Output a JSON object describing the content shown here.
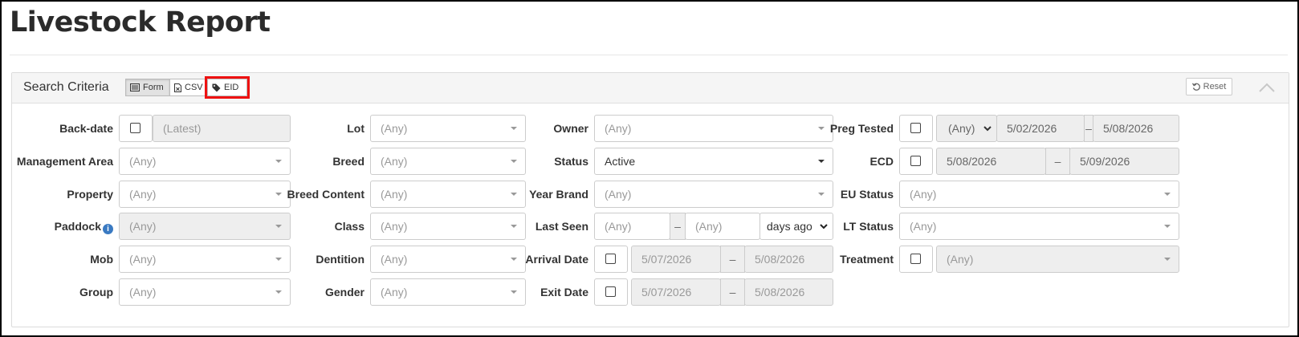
{
  "page": {
    "title": "Livestock Report"
  },
  "search": {
    "title": "Search Criteria",
    "modes": {
      "form": "Form",
      "csv": "CSV",
      "eid": "EID"
    },
    "reset_label": "Reset"
  },
  "fields": {
    "backdate": {
      "label": "Back-date",
      "value": "(Latest)"
    },
    "management_area": {
      "label": "Management Area",
      "value": "(Any)"
    },
    "property": {
      "label": "Property",
      "value": "(Any)"
    },
    "paddock": {
      "label": "Paddock",
      "value": "(Any)",
      "info": "i"
    },
    "mob": {
      "label": "Mob",
      "value": "(Any)"
    },
    "group": {
      "label": "Group",
      "value": "(Any)"
    },
    "lot": {
      "label": "Lot",
      "value": "(Any)"
    },
    "breed": {
      "label": "Breed",
      "value": "(Any)"
    },
    "breed_content": {
      "label": "Breed Content",
      "value": "(Any)"
    },
    "class": {
      "label": "Class",
      "value": "(Any)"
    },
    "dentition": {
      "label": "Dentition",
      "value": "(Any)"
    },
    "gender": {
      "label": "Gender",
      "value": "(Any)"
    },
    "owner": {
      "label": "Owner",
      "value": "(Any)"
    },
    "status": {
      "label": "Status",
      "value": "Active"
    },
    "year_brand": {
      "label": "Year Brand",
      "value": "(Any)"
    },
    "last_seen": {
      "label": "Last Seen",
      "from": "(Any)",
      "sep": "–",
      "to": "(Any)",
      "unit": "days ago"
    },
    "arrival_date": {
      "label": "Arrival Date",
      "from": "5/07/2026",
      "sep": "–",
      "to": "5/08/2026"
    },
    "exit_date": {
      "label": "Exit Date",
      "from": "5/07/2026",
      "sep": "–",
      "to": "5/08/2026"
    },
    "preg_tested": {
      "label": "Preg Tested",
      "select": "(Any)",
      "from": "5/02/2026",
      "sep": "–",
      "to": "5/08/2026"
    },
    "ecd": {
      "label": "ECD",
      "from": "5/08/2026",
      "sep": "–",
      "to": "5/09/2026"
    },
    "eu_status": {
      "label": "EU Status",
      "value": "(Any)"
    },
    "lt_status": {
      "label": "LT Status",
      "value": "(Any)"
    },
    "treatment": {
      "label": "Treatment",
      "value": "(Any)"
    }
  },
  "colors": {
    "highlight": "#e11111",
    "info": "#3a7ac2"
  }
}
